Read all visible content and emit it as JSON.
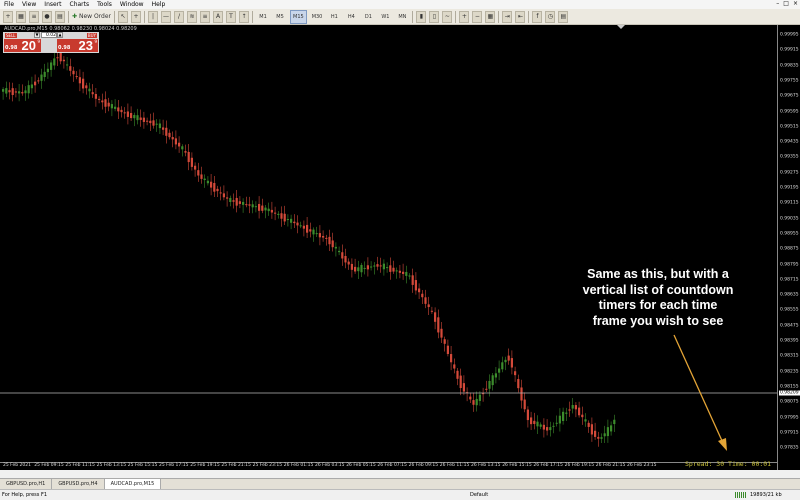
{
  "menu": [
    "File",
    "View",
    "Insert",
    "Charts",
    "Tools",
    "Window",
    "Help"
  ],
  "toolbar": {
    "new_order_label": "New Order",
    "timeframes": [
      "M1",
      "M5",
      "M15",
      "M30",
      "H1",
      "H4",
      "D1",
      "W1",
      "MN"
    ],
    "active_timeframe": "M15"
  },
  "chart": {
    "title": "AUDCAD.pro,M15  0.98062 0.98230 0.98024 0.98209",
    "price_labels": [
      "0.99995",
      "0.99915",
      "0.99835",
      "0.99755",
      "0.99675",
      "0.99595",
      "0.99515",
      "0.99435",
      "0.99355",
      "0.99275",
      "0.99195",
      "0.99115",
      "0.99035",
      "0.98955",
      "0.98875",
      "0.98795",
      "0.98715",
      "0.98635",
      "0.98555",
      "0.98475",
      "0.98395",
      "0.98315",
      "0.98235",
      "0.98155",
      "0.98075",
      "0.97995",
      "0.97915",
      "0.97835"
    ],
    "current_price": "0.98209",
    "time_labels": [
      "25 Feb 2021",
      "25 Feb 09:15",
      "25 Feb 11:15",
      "25 Feb 13:15",
      "25 Feb 15:15",
      "25 Feb 17:15",
      "25 Feb 19:15",
      "25 Feb 21:15",
      "25 Feb 23:15",
      "26 Feb 01:15",
      "26 Feb 03:15",
      "26 Feb 05:15",
      "26 Feb 07:15",
      "26 Feb 09:15",
      "26 Feb 11:15",
      "26 Feb 13:15",
      "26 Feb 15:15",
      "26 Feb 17:15",
      "26 Feb 19:15",
      "26 Feb 21:15",
      "26 Feb 23:15"
    ],
    "bull_color": "#3c8c2c",
    "bear_color": "#d44a3a",
    "bid_line_color": "#b8b8b8",
    "annotation_color": "#e3a436",
    "countdown_color": "#c8c03a"
  },
  "trade_panel": {
    "sell_label": "SELL",
    "buy_label": "BUY",
    "lot": "0.02",
    "sell_small": "0.98",
    "sell_big": "20",
    "sell_sup": "9",
    "buy_small": "0.98",
    "buy_big": "23",
    "buy_sup": "9"
  },
  "annotation": {
    "lines": [
      "Same as this, but with a",
      "vertical list of countdown",
      "timers for each time",
      "frame you wish to see"
    ]
  },
  "countdown": {
    "text": "Spread: 30  Time: 00:01"
  },
  "tabs": [
    {
      "label": "GBPUSD.pro,H1"
    },
    {
      "label": "GBPUSD.pro,H4"
    },
    {
      "label": "AUDCAD.pro,M15",
      "active": true
    }
  ],
  "status": {
    "help": "For Help, press F1",
    "profile": "Default",
    "traffic": "19893/21 kb"
  }
}
